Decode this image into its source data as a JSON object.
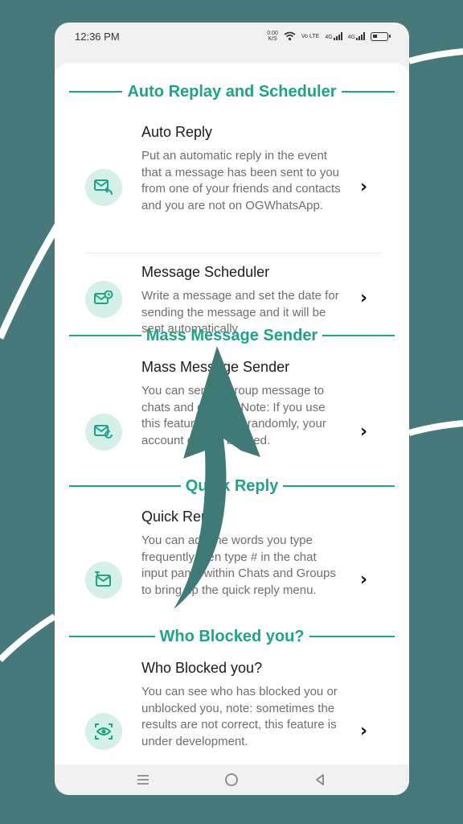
{
  "status_bar": {
    "time": "12:36 PM",
    "net_speed_value": "0.00",
    "net_speed_unit": "K/S",
    "volte": "Vo LTE",
    "signal1": "4G",
    "signal2": "4G",
    "icons": [
      "wifi-icon",
      "signal-icon",
      "signal-icon",
      "battery-icon"
    ]
  },
  "sections": [
    {
      "title": "Auto Replay and Scheduler",
      "items": [
        {
          "title": "Auto Reply",
          "description": "Put an automatic reply in the event that a message has been sent to you from one of your friends and contacts and you are not on OGWhatsApp.",
          "icon": "mail-reply-icon"
        },
        {
          "title": "Message Scheduler",
          "description": "Write a message and set the date for sending the message and it will be sent automatically",
          "icon": "mail-clock-icon"
        }
      ]
    },
    {
      "title": "Mass Message Sender",
      "items": [
        {
          "title": "Mass Message Sender",
          "description": "You can send a group message to chats and groups, Note: If you use this feature to send randomly, your account can be banned.",
          "icon": "mail-refresh-icon"
        }
      ]
    },
    {
      "title": "Quick Reply",
      "items": [
        {
          "title": "Quick Reply",
          "description": "You can add the words you type frequently then type # in the chat input panel within Chats and Groups to bring up the quick reply menu.",
          "icon": "quick-reply-icon"
        }
      ]
    },
    {
      "title": "Who Blocked you?",
      "items": [
        {
          "title": "Who Blocked you?",
          "description": "You can see who has blocked you or unblocked you, note: sometimes the results are not correct, this feature is under development.",
          "icon": "eye-scan-icon"
        }
      ]
    }
  ],
  "nav": {
    "icons": [
      "menu-icon",
      "home-icon",
      "back-icon"
    ]
  },
  "colors": {
    "accent": "#1fa386",
    "background": "#47797a",
    "icon_circle": "#d4f0e8",
    "arrow": "#3f7a76"
  }
}
